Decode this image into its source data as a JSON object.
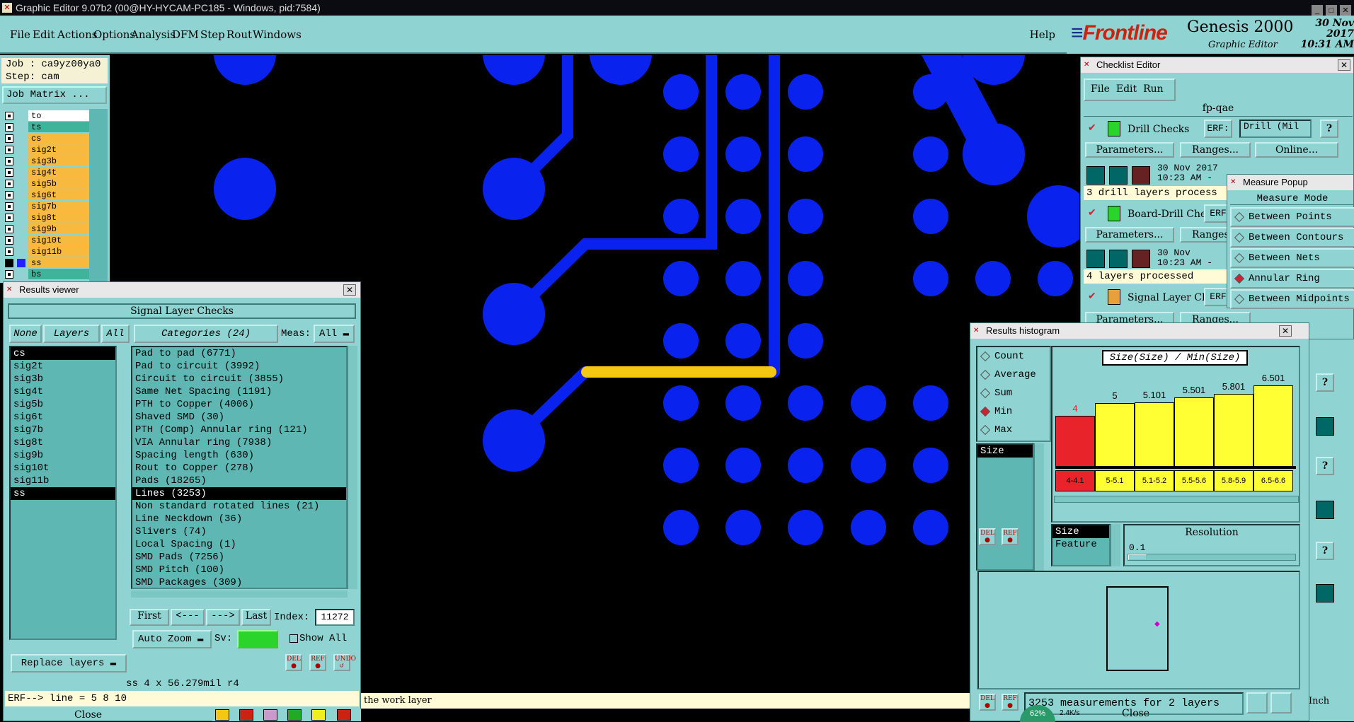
{
  "window": {
    "title": "Graphic Editor 9.07b2 (00@HY-HYCAM-PC185 - Windows, pid:7584)"
  },
  "menu": {
    "items": [
      "File",
      "Edit",
      "Actions",
      "Options",
      "Analysis",
      "DFM",
      "Step",
      "Rout",
      "Windows"
    ],
    "help": "Help"
  },
  "brand": {
    "logo": "Frontline",
    "product": "Genesis 2000",
    "subtitle": "Graphic Editor",
    "date": "30 Nov 2017",
    "time": "10:31 AM"
  },
  "job": {
    "job_label": "Job : ca9yz00ya0",
    "step_label": "Step: cam",
    "matrix_button": "Job Matrix ..."
  },
  "layers": [
    {
      "name": "to",
      "color": "#ffffff"
    },
    {
      "name": "ts",
      "color": "#3fb49a"
    },
    {
      "name": "cs",
      "color": "#f7b93e"
    },
    {
      "name": "sig2t",
      "color": "#f7b93e"
    },
    {
      "name": "sig3b",
      "color": "#f7b93e"
    },
    {
      "name": "sig4t",
      "color": "#f7b93e"
    },
    {
      "name": "sig5b",
      "color": "#f7b93e"
    },
    {
      "name": "sig6t",
      "color": "#f7b93e"
    },
    {
      "name": "sig7b",
      "color": "#f7b93e"
    },
    {
      "name": "sig8t",
      "color": "#f7b93e"
    },
    {
      "name": "sig9b",
      "color": "#f7b93e"
    },
    {
      "name": "sig10t",
      "color": "#f7b93e"
    },
    {
      "name": "sig11b",
      "color": "#f7b93e"
    },
    {
      "name": "ss",
      "color": "#f7b93e"
    },
    {
      "name": "bs",
      "color": "#3fb49a"
    }
  ],
  "results_viewer": {
    "title": "Results viewer",
    "header": "Signal Layer Checks",
    "none_btn": "None",
    "layers_btn": "Layers",
    "all_btn": "All",
    "categories_label": "Categories (24)",
    "meas_label": "Meas:",
    "meas_value": "All",
    "layer_list": [
      "cs",
      "sig2t",
      "sig3b",
      "sig4t",
      "sig5b",
      "sig6t",
      "sig7b",
      "sig8t",
      "sig9b",
      "sig10t",
      "sig11b",
      "ss"
    ],
    "categories": [
      "Pad to pad (6771)",
      "Pad to circuit (3992)",
      "Circuit to circuit (3855)",
      "Same Net Spacing (1191)",
      "PTH to Copper (4006)",
      "Shaved SMD (30)",
      "PTH (Comp) Annular ring (121)",
      "VIA Annular ring (7938)",
      "Spacing length (630)",
      "Rout to Copper (278)",
      "Pads (18265)",
      "Lines (3253)",
      "Non standard rotated lines (21)",
      "Line Neckdown (36)",
      "Slivers (74)",
      "Local Spacing (1)",
      "SMD Pads (7256)",
      "SMD Pitch (100)",
      "SMD Packages (309)"
    ],
    "nav": {
      "first": "First",
      "prev": "<---",
      "next": "--->",
      "last": "Last",
      "index_label": "Index:",
      "index_value": "11272"
    },
    "auto_zoom": "Auto Zoom",
    "sv_label": "Sv:",
    "show_all": "Show All",
    "replace_layers": "Replace layers",
    "info_line": "ss 4 x 56.279mil  r4",
    "erf_line": "ERF--> line = 5 8 10",
    "close": "Close",
    "del": "DEL",
    "ref": "REF",
    "undo": "UNDO"
  },
  "status": {
    "work_layer_msg": "the work layer"
  },
  "checklist": {
    "title": "Checklist Editor",
    "menu": [
      "File",
      "Edit",
      "Run"
    ],
    "name": "fp-qae",
    "items": [
      {
        "label": "Drill Checks",
        "erf_label": "ERF:",
        "erf_value": "Drill (Mil",
        "date": "30 Nov 2017",
        "time": "10:23 AM -",
        "status": "3 drill layers process"
      },
      {
        "label": "Board-Drill Che",
        "erf_label": "ERF",
        "date": "30 Nov",
        "time": "10:23 AM -",
        "status": "4 layers processed"
      },
      {
        "label": "Signal Layer Ch",
        "erf_label": "ERF"
      }
    ],
    "params": "Parameters...",
    "ranges": "Ranges...",
    "online": "Online..."
  },
  "measure": {
    "title": "Measure Popup",
    "header": "Measure Mode",
    "modes": [
      {
        "label": "Between Points",
        "on": false
      },
      {
        "label": "Between Contours",
        "on": false
      },
      {
        "label": "Between Nets",
        "on": false
      },
      {
        "label": "Annular Ring",
        "on": true
      },
      {
        "label": "Between Midpoints",
        "on": false
      }
    ]
  },
  "histogram": {
    "title": "Results histogram",
    "options": [
      {
        "label": "Count",
        "on": false
      },
      {
        "label": "Average",
        "on": false
      },
      {
        "label": "Sum",
        "on": false
      },
      {
        "label": "Min",
        "on": true
      },
      {
        "label": "Max",
        "on": false
      }
    ],
    "size_list": [
      "Size"
    ],
    "chart_title": "Size(Size) / Min(Size)",
    "bars": [
      {
        "value": "4",
        "range": "4-4.1",
        "color": "#e8242a",
        "level": 0.52
      },
      {
        "value": "5",
        "range": "5-5.1",
        "color": "#ffff33",
        "level": 0.65
      },
      {
        "value": "5.101",
        "range": "5.1-5.2",
        "color": "#ffff33",
        "level": 0.66
      },
      {
        "value": "5.501",
        "range": "5.5-5.6",
        "color": "#ffff33",
        "level": 0.71
      },
      {
        "value": "5.801",
        "range": "5.8-5.9",
        "color": "#ffff33",
        "level": 0.74
      },
      {
        "value": "6.501",
        "range": "6.5-6.6",
        "color": "#ffff33",
        "level": 0.83
      }
    ],
    "field_list": [
      "Size",
      "Feature"
    ],
    "resolution_label": "Resolution",
    "resolution_value": "0.1",
    "footer": "3253 measurements for 2 layers",
    "close": "Close",
    "net_pct": "62%",
    "net_rate": "2.4K/s"
  },
  "right_strip": {
    "inch": "Inch"
  }
}
